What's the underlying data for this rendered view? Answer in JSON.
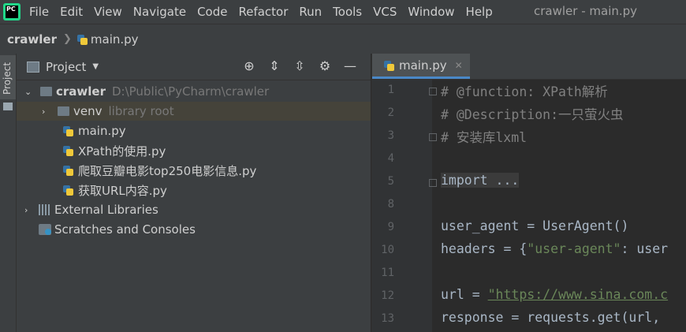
{
  "menubar": {
    "logo_text": "PC",
    "items": [
      "File",
      "Edit",
      "View",
      "Navigate",
      "Code",
      "Refactor",
      "Run",
      "Tools",
      "VCS",
      "Window",
      "Help"
    ],
    "window_title": "crawler - main.py"
  },
  "breadcrumb": {
    "root": "crawler",
    "separator": "❯",
    "file": "main.py"
  },
  "sidebar": {
    "tab_label": "Project"
  },
  "project_panel": {
    "title": "Project",
    "tree": [
      {
        "label": "crawler",
        "hint": "D:\\Public\\PyCharm\\crawler"
      },
      {
        "label": "venv",
        "hint": "library root"
      },
      {
        "label": "main.py"
      },
      {
        "label": "XPath的使用.py"
      },
      {
        "label": "爬取豆瓣电影top250电影信息.py"
      },
      {
        "label": "获取URL内容.py"
      },
      {
        "label": "External Libraries"
      },
      {
        "label": "Scratches and Consoles"
      }
    ]
  },
  "editor": {
    "tab_label": "main.py",
    "lines": [
      {
        "num": "1",
        "text": "# @function: XPath解析"
      },
      {
        "num": "2",
        "text": "# @Description:一只萤火虫"
      },
      {
        "num": "3",
        "text": "# 安装库lxml"
      },
      {
        "num": "4",
        "text": ""
      },
      {
        "num": "5",
        "text": "import ..."
      },
      {
        "num": "8",
        "text": ""
      },
      {
        "num": "9",
        "text": "user_agent = UserAgent()"
      },
      {
        "num": "10",
        "text_a": "headers = {",
        "text_b": "\"user-agent\"",
        "text_c": ": user"
      },
      {
        "num": "11",
        "text": ""
      },
      {
        "num": "12",
        "text_a": "url = ",
        "text_b": "\"https://www.sina.com.c"
      },
      {
        "num": "13",
        "text": "response = requests.get(url,"
      }
    ]
  }
}
